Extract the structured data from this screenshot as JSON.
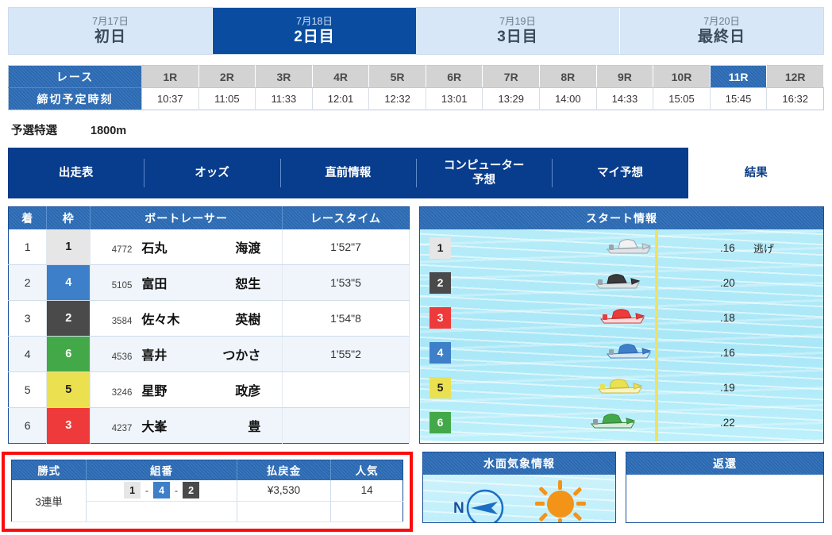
{
  "day_tabs": [
    {
      "date": "7月17日",
      "name": "初日",
      "active": false
    },
    {
      "date": "7月18日",
      "name": "2日目",
      "active": true
    },
    {
      "date": "7月19日",
      "name": "3日目",
      "active": false
    },
    {
      "date": "7月20日",
      "name": "最終日",
      "active": false
    }
  ],
  "race_grid": {
    "row_label_race": "レース",
    "row_label_deadline": "締切予定時刻",
    "races": [
      "1R",
      "2R",
      "3R",
      "4R",
      "5R",
      "6R",
      "7R",
      "8R",
      "9R",
      "10R",
      "11R",
      "12R"
    ],
    "times": [
      "10:37",
      "11:05",
      "11:33",
      "12:01",
      "12:32",
      "13:01",
      "13:29",
      "14:00",
      "14:33",
      "15:05",
      "15:45",
      "16:32"
    ],
    "selected_race": "11R"
  },
  "race_title": {
    "grade": "予選特選",
    "distance": "1800m"
  },
  "content_tabs": [
    {
      "label": "出走表",
      "active": false
    },
    {
      "label": "オッズ",
      "active": false
    },
    {
      "label": "直前情報",
      "active": false
    },
    {
      "label": "コンピューター\n予想",
      "line1": "コンピューター",
      "line2": "予想",
      "active": false
    },
    {
      "label": "マイ予想",
      "active": false
    },
    {
      "label": "結果",
      "active": true
    }
  ],
  "results": {
    "headers": {
      "rank": "着",
      "frame": "枠",
      "racer": "ボートレーサー",
      "time": "レースタイム"
    },
    "rows": [
      {
        "rank": "1",
        "frame": "1",
        "frame_class": "f1",
        "reg_no": "4772",
        "surname": "石丸",
        "given": "海渡",
        "race_time": "1'52\"7"
      },
      {
        "rank": "2",
        "frame": "4",
        "frame_class": "f4",
        "reg_no": "5105",
        "surname": "富田",
        "given": "恕生",
        "race_time": "1'53\"5"
      },
      {
        "rank": "3",
        "frame": "2",
        "frame_class": "f2",
        "reg_no": "3584",
        "surname": "佐々木",
        "given": "英樹",
        "race_time": "1'54\"8"
      },
      {
        "rank": "4",
        "frame": "6",
        "frame_class": "f6",
        "reg_no": "4536",
        "surname": "喜井",
        "given": "つかさ",
        "race_time": "1'55\"2"
      },
      {
        "rank": "5",
        "frame": "5",
        "frame_class": "f5",
        "reg_no": "3246",
        "surname": "星野",
        "given": "政彦",
        "race_time": ""
      },
      {
        "rank": "6",
        "frame": "3",
        "frame_class": "f3",
        "reg_no": "4237",
        "surname": "大峯",
        "given": "豊",
        "race_time": ""
      }
    ]
  },
  "start_info": {
    "title": "スタート情報",
    "lanes": [
      {
        "lane": "1",
        "frame_class": "f1",
        "boat_color": "#f2f2f2",
        "st": ".16",
        "kimarite": "逃げ",
        "offset": 232
      },
      {
        "lane": "2",
        "frame_class": "f2",
        "boat_color": "#3a3a3a",
        "st": ".20",
        "kimarite": "",
        "offset": 218
      },
      {
        "lane": "3",
        "frame_class": "f3",
        "boat_color": "#ee3a3a",
        "st": ".18",
        "kimarite": "",
        "offset": 224
      },
      {
        "lane": "4",
        "frame_class": "f4",
        "boat_color": "#3d7fc8",
        "st": ".16",
        "kimarite": "",
        "offset": 232
      },
      {
        "lane": "5",
        "frame_class": "f5",
        "boat_color": "#ebe04f",
        "st": ".19",
        "kimarite": "",
        "offset": 221
      },
      {
        "lane": "6",
        "frame_class": "f6",
        "boat_color": "#43a948",
        "st": ".22",
        "kimarite": "",
        "offset": 212
      }
    ]
  },
  "payout": {
    "headers": {
      "kind": "勝式",
      "combo": "組番",
      "payout": "払戻金",
      "popularity": "人気"
    },
    "kind": "3連単",
    "combo": [
      {
        "num": "1",
        "frame_class": "f1"
      },
      {
        "num": "4",
        "frame_class": "f4"
      },
      {
        "num": "2",
        "frame_class": "f2"
      }
    ],
    "separator": "-",
    "amount": "¥3,530",
    "popularity": "14"
  },
  "weather": {
    "title": "水面気象情報",
    "compass_label": "N"
  },
  "refund": {
    "title": "返還"
  },
  "colors": {
    "brand_blue": "#083c8c",
    "header_blue": "#2a69b2",
    "accent_red": "#fb0d0d",
    "start_line_yellow": "#f2e15c"
  }
}
